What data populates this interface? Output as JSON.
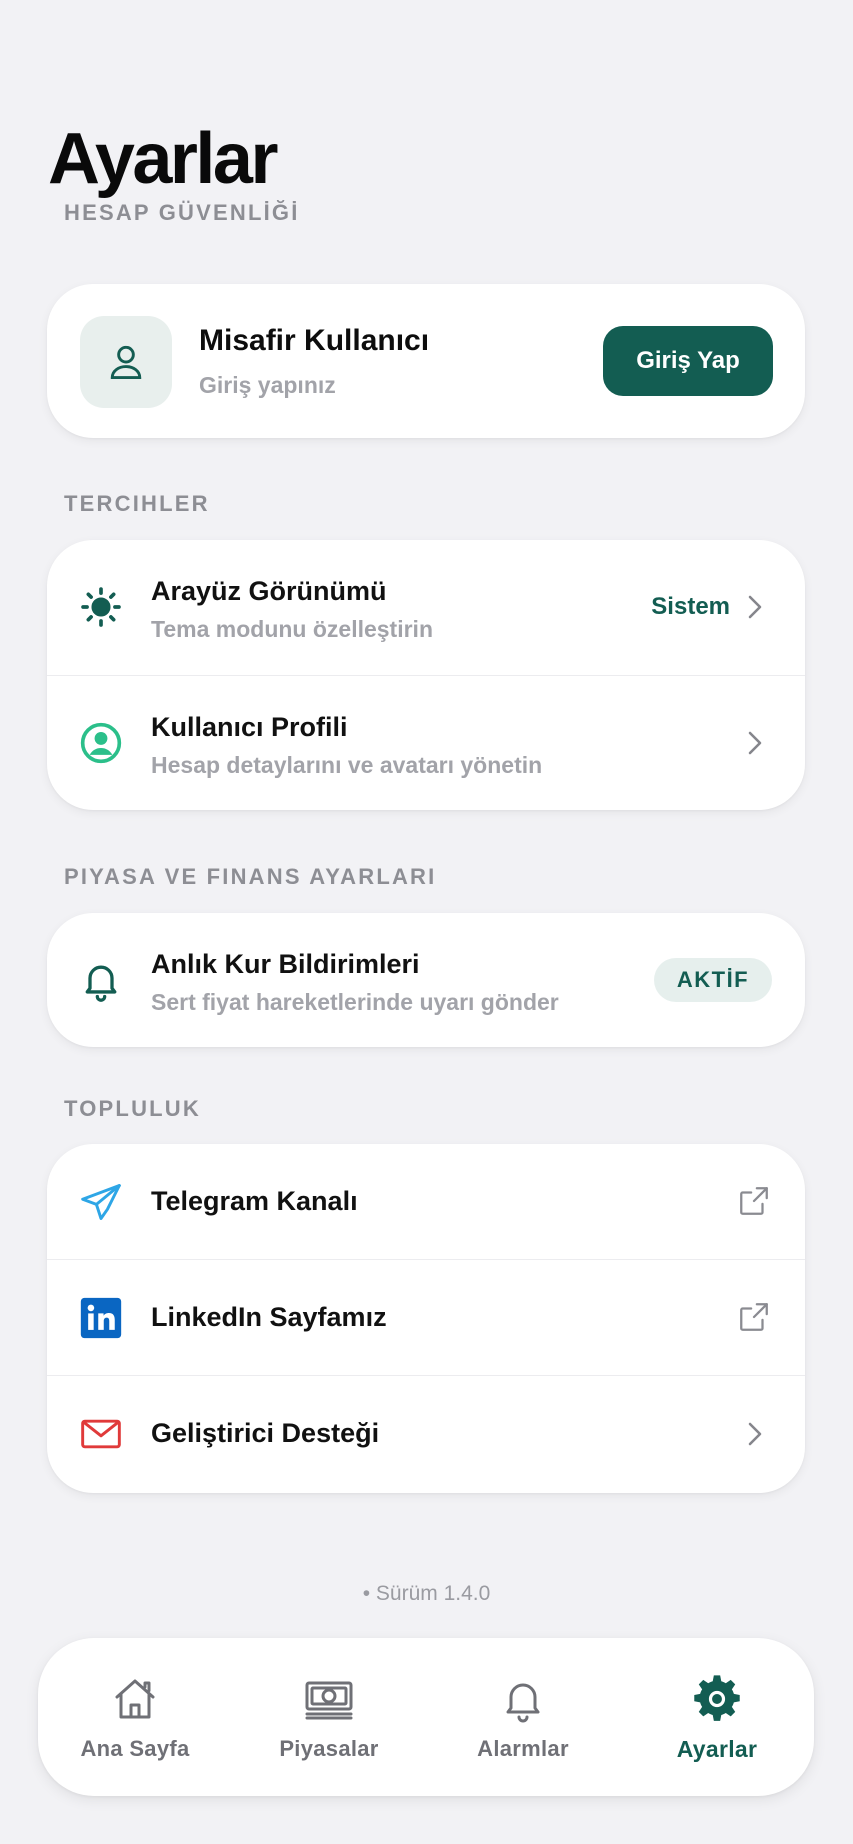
{
  "page": {
    "title": "Ayarlar"
  },
  "colors": {
    "accent": "#135d52",
    "background": "#f2f2f5",
    "telegram": "#2ea6e6",
    "linkedin": "#0a66c2",
    "mail": "#e03a3a",
    "profile": "#2bbf8a"
  },
  "sections": {
    "security": "HESAP GÜVENLİĞİ",
    "preferences": "TERCIHLER",
    "market": "PIYASA VE FINANS AYARLARI",
    "community": "TOPLULUK"
  },
  "account": {
    "icon": "user-icon",
    "name": "Misafir Kullanıcı",
    "subtitle": "Giriş yapınız",
    "login_label": "Giriş Yap"
  },
  "preferences": [
    {
      "icon": "sun-icon",
      "title": "Arayüz Görünümü",
      "subtitle": "Tema modunu özelleştirin",
      "value": "Sistem"
    },
    {
      "icon": "user-circle-icon",
      "title": "Kullanıcı Profili",
      "subtitle": "Hesap detaylarını ve avatarı yönetin"
    }
  ],
  "market": {
    "icon": "bell-icon",
    "title": "Anlık Kur Bildirimleri",
    "subtitle": "Sert fiyat hareketlerinde uyarı gönder",
    "badge": "AKTİF"
  },
  "community": [
    {
      "icon": "telegram-icon",
      "title": "Telegram Kanalı",
      "action": "external-link-icon"
    },
    {
      "icon": "linkedin-icon",
      "title": "LinkedIn Sayfamız",
      "action": "external-link-icon"
    },
    {
      "icon": "mail-icon",
      "title": "Geliştirici Desteği",
      "action": "chevron-right-icon"
    }
  ],
  "version": "• Sürüm 1.4.0",
  "tabbar": [
    {
      "icon": "home-icon",
      "label": "Ana Sayfa",
      "active": false
    },
    {
      "icon": "banknote-icon",
      "label": "Piyasalar",
      "active": false
    },
    {
      "icon": "bell-icon",
      "label": "Alarmlar",
      "active": false
    },
    {
      "icon": "gear-icon",
      "label": "Ayarlar",
      "active": true
    }
  ]
}
